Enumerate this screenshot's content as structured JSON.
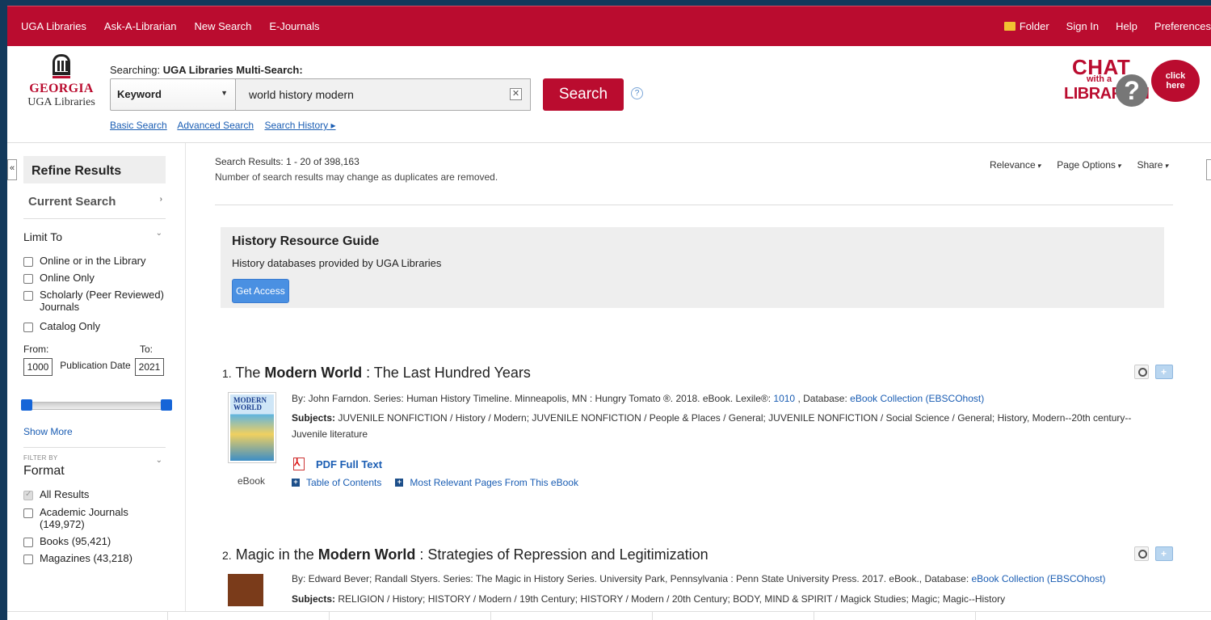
{
  "topbar": {
    "left": [
      "UGA Libraries",
      "Ask-A-Librarian",
      "New Search",
      "E-Journals"
    ],
    "right": {
      "folder": "Folder",
      "signin": "Sign In",
      "help": "Help",
      "prefs": "Preferences"
    }
  },
  "logo": {
    "georgia": "GEORGIA",
    "libraries": "UGA Libraries"
  },
  "search": {
    "searching_label": "Searching: ",
    "searching_target": "UGA Libraries Multi-Search:",
    "field_type": "Keyword",
    "query": "world history modern",
    "button": "Search",
    "help": "?",
    "links": {
      "basic": "Basic Search",
      "advanced": "Advanced Search",
      "history": "Search History ▸"
    }
  },
  "chat": {
    "l1": "CHAT",
    "l2": "with a",
    "l3": "LIBRARIAN",
    "q": "?",
    "bubble1": "click",
    "bubble2": "here"
  },
  "sidebar": {
    "collapse": "«",
    "refine": "Refine Results",
    "current_search": "Current Search",
    "limit_to": "Limit To",
    "limits": [
      "Online or in the Library",
      "Online Only",
      "Scholarly (Peer Reviewed) Journals",
      "Catalog Only"
    ],
    "from_label": "From:",
    "to_label": "To:",
    "from_value": "1000",
    "to_value": "2021",
    "pub_date": "Publication Date",
    "show_more": "Show More",
    "filter_by": "FILTER BY",
    "format": "Format",
    "formats": [
      "All Results",
      "Academic Journals (149,972)",
      "Books (95,421)",
      "Magazines (43,218)"
    ]
  },
  "main": {
    "count": "Search Results: 1 - 20 of 398,163",
    "note": "Number of search results may change as duplicates are removed.",
    "sort": "Relevance",
    "page_options": "Page Options",
    "share": "Share",
    "guide": {
      "title": "History Resource Guide",
      "desc": "History databases provided by UGA Libraries",
      "button": "Get Access"
    },
    "results": [
      {
        "num": "1.",
        "title_pre": "The ",
        "title_bold": "Modern World",
        "title_post": " : The Last Hundred Years",
        "by_line": "By: John Farndon. Series: Human History Timeline. Minneapolis, MN : Hungry Tomato ®. 2018. eBook. Lexile®: ",
        "lexile": "1010",
        "db_label": " , Database: ",
        "database": "eBook Collection (EBSCOhost)",
        "subjects_label": "Subjects:",
        "subjects": " JUVENILE NONFICTION / History / Modern; JUVENILE NONFICTION / People & Places / General; JUVENILE NONFICTION / Social Science / General; History, Modern--20th century--Juvenile literature",
        "pdf": "PDF Full Text",
        "toc": "Table of Contents",
        "relevant": "Most Relevant Pages From This eBook",
        "type": "eBook",
        "cover_text": "MODERN WORLD"
      },
      {
        "num": "2.",
        "title_pre": "Magic in the ",
        "title_bold": "Modern World",
        "title_post": " : Strategies of Repression and Legitimization",
        "by_line": "By: Edward Bever; Randall Styers. Series: The Magic in History Series. University Park, Pennsylvania : Penn State University Press. 2017. eBook., Database: ",
        "database": "eBook Collection (EBSCOhost)",
        "subjects_label": "Subjects:",
        "subjects": " RELIGION / History; HISTORY / Modern / 19th Century; HISTORY / Modern / 20th Century; BODY, MIND & SPIRIT / Magick Studies; Magic; Magic--History"
      }
    ]
  },
  "colors": {
    "brand_red": "#ba0c2f",
    "link_blue": "#1a5db3",
    "outer_bg": "#13395b"
  }
}
